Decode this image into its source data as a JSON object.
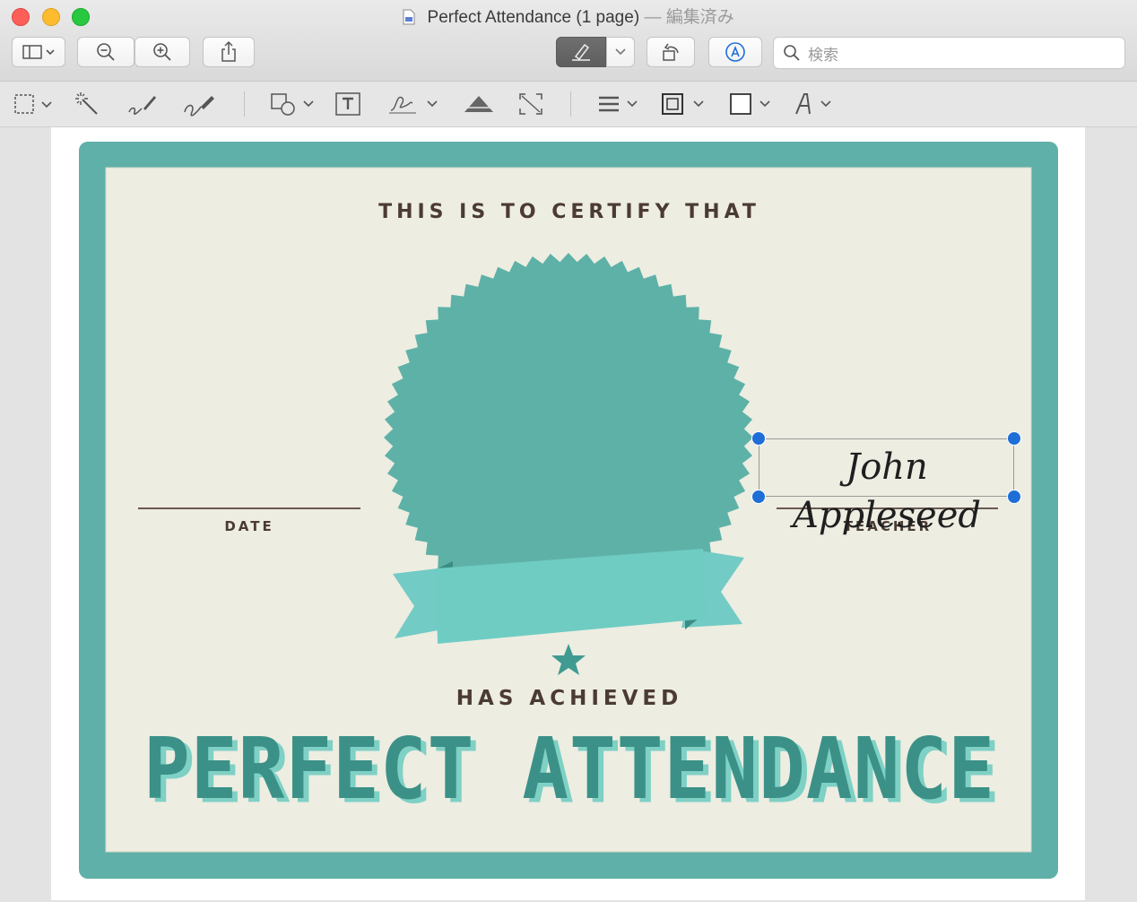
{
  "window": {
    "title": "Perfect Attendance (1 page)",
    "status": "— 編集済み"
  },
  "toolbar": {
    "search_placeholder": "検索",
    "icons": [
      "sidebar-icon",
      "zoom-out-icon",
      "zoom-in-icon",
      "share-icon",
      "highlight-icon",
      "rotate-icon",
      "markup-icon",
      "search-icon"
    ]
  },
  "markup_toolbar": {
    "icons": [
      "rect-select-icon",
      "instant-alpha-icon",
      "sketch-icon",
      "draw-icon",
      "shapes-icon",
      "text-icon",
      "sign-icon",
      "adjust-color-icon",
      "adjust-size-icon",
      "line-style-icon",
      "border-color-icon",
      "fill-color-icon",
      "text-style-icon"
    ]
  },
  "certificate": {
    "heading": "THIS IS TO CERTIFY THAT",
    "date_label": "DATE",
    "teacher_label": "TEACHER",
    "achieved_label": "HAS ACHIEVED",
    "award_title": "PERFECT ATTENDANCE",
    "signature": "John Appleseed"
  },
  "colors": {
    "teal_border": "#5fb0a8",
    "paper": "#edede2",
    "seal": "#5eb1a7",
    "ribbon": "#72cbc4",
    "text_brown": "#4b3b33",
    "handle_blue": "#1f6ed8"
  }
}
